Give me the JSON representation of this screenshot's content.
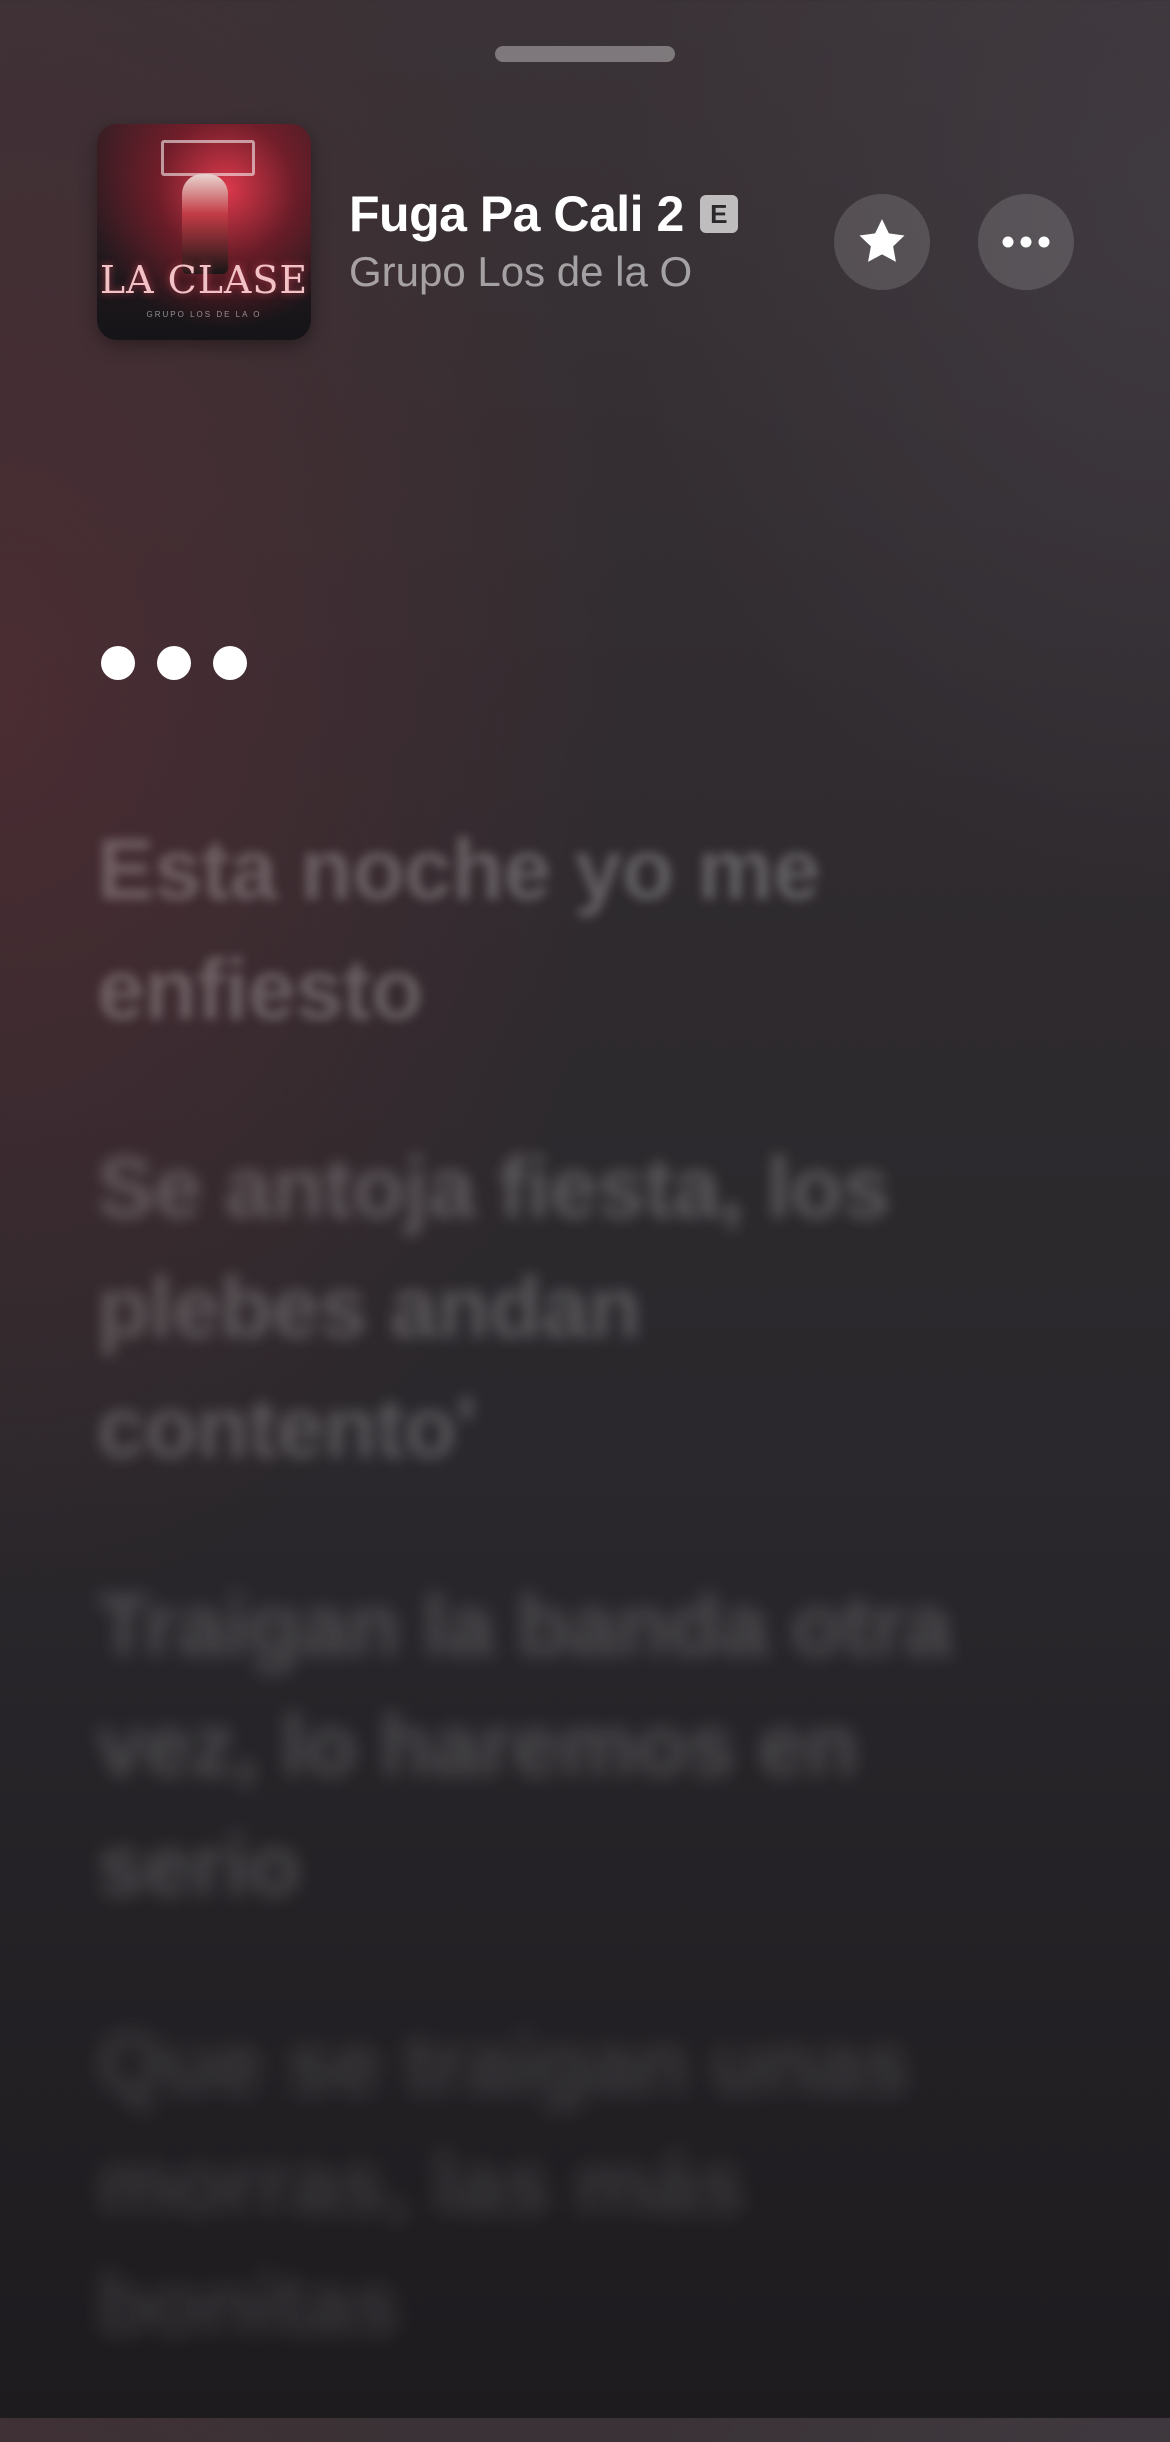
{
  "header": {
    "song_title": "Fuga Pa Cali 2",
    "explicit_badge": "E",
    "artist": "Grupo Los de la O",
    "artwork": {
      "title_text": "LA CLASE",
      "subtitle_text": "GRUPO LOS DE LA O"
    },
    "favorite_icon": "star-icon",
    "more_icon": "ellipsis-icon"
  },
  "lyrics": {
    "loading_indicator": "•••",
    "lines": [
      "Esta noche yo me enfiesto",
      "Se antoja fiesta, los plebes andan contento'",
      "Traigan la banda otra vez, lo haremos en serio",
      "Que se traigan unas morras, las más bonitas"
    ]
  },
  "colors": {
    "background_top": "#3a3236",
    "background_bottom": "#1d1b1e",
    "accent_red": "#c23b45",
    "text_primary": "#ffffff"
  }
}
